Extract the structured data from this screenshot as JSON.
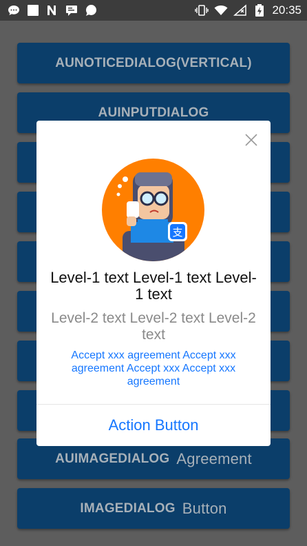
{
  "status_bar": {
    "time": "20:35",
    "left_icons": [
      "message-bubble-icon",
      "square-icon",
      "n-logo-icon",
      "chat-icon",
      "whatsapp-icon"
    ],
    "right_icons": [
      "vibrate-icon",
      "wifi-icon",
      "no-signal-icon",
      "battery-charging-icon"
    ]
  },
  "background_list": {
    "items": [
      {
        "label": "AUNOTICEDIALOG(VERTICAL)",
        "suffix": ""
      },
      {
        "label": "AUINPUTDIALOG",
        "suffix": ""
      },
      {
        "label": "",
        "suffix": ""
      },
      {
        "label": "",
        "suffix": ""
      },
      {
        "label": "",
        "suffix": ""
      },
      {
        "label": "",
        "suffix": ""
      },
      {
        "label": "",
        "suffix": ""
      },
      {
        "label": "",
        "suffix": ""
      },
      {
        "label": "AUIMAGEDIALOG",
        "suffix": "Agreement"
      },
      {
        "label": "IMAGEDIALOG",
        "suffix": "Button"
      }
    ]
  },
  "dialog": {
    "image": "crying-character-illustration",
    "level1_text": "Level-1 text Level-1 text Level-1 text",
    "level2_text": "Level-2 text Level-2 text Level-2 text",
    "agreement_text": "Accept xxx agreement Accept xxx agreement Accept xxx Accept xxx agreement",
    "action_button": "Action Button"
  },
  "colors": {
    "accent": "#1677ff",
    "list_button": "#0b3e6a",
    "avatar_bg": "#ff7f00"
  }
}
